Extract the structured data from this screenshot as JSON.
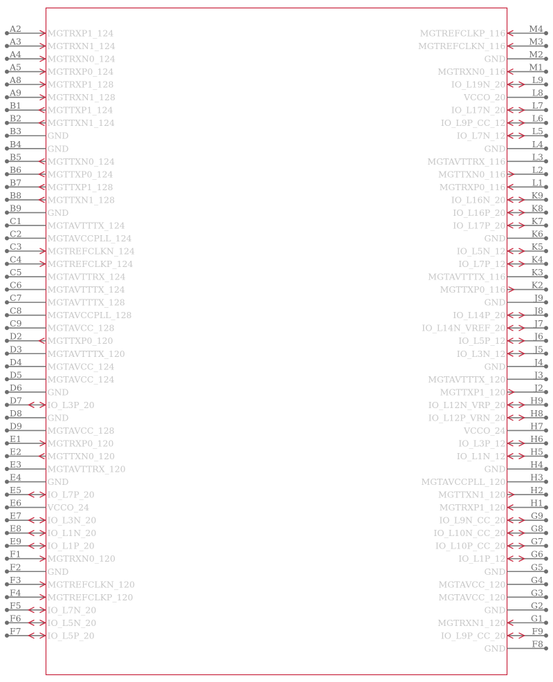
{
  "component": {
    "type": "schematic-symbol",
    "colors": {
      "body": "#c8243c",
      "pin_line": "#7a7a7a",
      "pin_name": "#c8c8c8",
      "pin_number": "#6e6e6e"
    }
  },
  "left_pins": [
    {
      "num": "A2",
      "name": "MGTRXP1_124",
      "dir": "in"
    },
    {
      "num": "A3",
      "name": "MGTRXN1_124",
      "dir": "in"
    },
    {
      "num": "A4",
      "name": "MGTRXN0_124",
      "dir": "in"
    },
    {
      "num": "A5",
      "name": "MGTRXP0_124",
      "dir": "in"
    },
    {
      "num": "A8",
      "name": "MGTRXP1_128",
      "dir": "in"
    },
    {
      "num": "A9",
      "name": "MGTRXN1_128",
      "dir": "in"
    },
    {
      "num": "B1",
      "name": "MGTTXP1_124",
      "dir": "out"
    },
    {
      "num": "B2",
      "name": "MGTTXN1_124",
      "dir": "out"
    },
    {
      "num": "B3",
      "name": "GND",
      "dir": "pwr"
    },
    {
      "num": "B4",
      "name": "GND",
      "dir": "pwr"
    },
    {
      "num": "B5",
      "name": "MGTTXN0_124",
      "dir": "out"
    },
    {
      "num": "B6",
      "name": "MGTTXP0_124",
      "dir": "out"
    },
    {
      "num": "B7",
      "name": "MGTTXP1_128",
      "dir": "out"
    },
    {
      "num": "B8",
      "name": "MGTTXN1_128",
      "dir": "out"
    },
    {
      "num": "B9",
      "name": "GND",
      "dir": "pwr"
    },
    {
      "num": "C1",
      "name": "MGTAVTTTX_124",
      "dir": "pwr"
    },
    {
      "num": "C2",
      "name": "MGTAVCCPLL_124",
      "dir": "pwr"
    },
    {
      "num": "C3",
      "name": "MGTREFCLKN_124",
      "dir": "in"
    },
    {
      "num": "C4",
      "name": "MGTREFCLKP_124",
      "dir": "in"
    },
    {
      "num": "C5",
      "name": "MGTAVTTRX_124",
      "dir": "pwr"
    },
    {
      "num": "C6",
      "name": "MGTAVTTTX_124",
      "dir": "pwr"
    },
    {
      "num": "C7",
      "name": "MGTAVTTTX_128",
      "dir": "pwr"
    },
    {
      "num": "C8",
      "name": "MGTAVCCPLL_128",
      "dir": "pwr"
    },
    {
      "num": "C9",
      "name": "MGTAVCC_128",
      "dir": "pwr"
    },
    {
      "num": "D2",
      "name": "MGTTXP0_120",
      "dir": "out"
    },
    {
      "num": "D3",
      "name": "MGTAVTTTX_120",
      "dir": "pwr"
    },
    {
      "num": "D4",
      "name": "MGTAVCC_124",
      "dir": "pwr"
    },
    {
      "num": "D5",
      "name": "MGTAVCC_124",
      "dir": "pwr"
    },
    {
      "num": "D6",
      "name": "GND",
      "dir": "pwr"
    },
    {
      "num": "D7",
      "name": "IO_L3P_20",
      "dir": "bidir"
    },
    {
      "num": "D8",
      "name": "GND",
      "dir": "pwr"
    },
    {
      "num": "D9",
      "name": "MGTAVCC_128",
      "dir": "pwr"
    },
    {
      "num": "E1",
      "name": "MGTRXP0_120",
      "dir": "in"
    },
    {
      "num": "E2",
      "name": "MGTTXN0_120",
      "dir": "out"
    },
    {
      "num": "E3",
      "name": "MGTAVTTRX_120",
      "dir": "pwr"
    },
    {
      "num": "E4",
      "name": "GND",
      "dir": "pwr"
    },
    {
      "num": "E5",
      "name": "IO_L7P_20",
      "dir": "bidir"
    },
    {
      "num": "E6",
      "name": "VCCO_24",
      "dir": "pwr"
    },
    {
      "num": "E7",
      "name": "IO_L3N_20",
      "dir": "bidir"
    },
    {
      "num": "E8",
      "name": "IO_L1N_20",
      "dir": "bidir"
    },
    {
      "num": "E9",
      "name": "IO_L1P_20",
      "dir": "bidir"
    },
    {
      "num": "F1",
      "name": "MGTRXN0_120",
      "dir": "in"
    },
    {
      "num": "F2",
      "name": "GND",
      "dir": "pwr"
    },
    {
      "num": "F3",
      "name": "MGTREFCLKN_120",
      "dir": "in"
    },
    {
      "num": "F4",
      "name": "MGTREFCLKP_120",
      "dir": "in"
    },
    {
      "num": "F5",
      "name": "IO_L7N_20",
      "dir": "bidir"
    },
    {
      "num": "F6",
      "name": "IO_L5N_20",
      "dir": "bidir"
    },
    {
      "num": "F7",
      "name": "IO_L5P_20",
      "dir": "bidir"
    }
  ],
  "right_pins": [
    {
      "num": "M4",
      "name": "MGTREFCLKP_116",
      "dir": "in"
    },
    {
      "num": "M3",
      "name": "MGTREFCLKN_116",
      "dir": "in"
    },
    {
      "num": "M2",
      "name": "GND",
      "dir": "pwr"
    },
    {
      "num": "M1",
      "name": "MGTRXN0_116",
      "dir": "in"
    },
    {
      "num": "L9",
      "name": "IO_L19N_20",
      "dir": "bidir"
    },
    {
      "num": "L8",
      "name": "VCCO_20",
      "dir": "pwr"
    },
    {
      "num": "L7",
      "name": "IO_L17N_20",
      "dir": "bidir"
    },
    {
      "num": "L6",
      "name": "IO_L9P_CC_12",
      "dir": "bidir"
    },
    {
      "num": "L5",
      "name": "IO_L7N_12",
      "dir": "bidir"
    },
    {
      "num": "L4",
      "name": "GND",
      "dir": "pwr"
    },
    {
      "num": "L3",
      "name": "MGTAVTTRX_116",
      "dir": "pwr"
    },
    {
      "num": "L2",
      "name": "MGTTXN0_116",
      "dir": "out"
    },
    {
      "num": "L1",
      "name": "MGTRXP0_116",
      "dir": "in"
    },
    {
      "num": "K9",
      "name": "IO_L16N_20",
      "dir": "bidir"
    },
    {
      "num": "K8",
      "name": "IO_L16P_20",
      "dir": "bidir"
    },
    {
      "num": "K7",
      "name": "IO_L17P_20",
      "dir": "bidir"
    },
    {
      "num": "K6",
      "name": "GND",
      "dir": "pwr"
    },
    {
      "num": "K5",
      "name": "IO_L5N_12",
      "dir": "bidir"
    },
    {
      "num": "K4",
      "name": "IO_L7P_12",
      "dir": "bidir"
    },
    {
      "num": "K3",
      "name": "MGTAVTTTX_116",
      "dir": "pwr"
    },
    {
      "num": "K2",
      "name": "MGTTXP0_116",
      "dir": "out"
    },
    {
      "num": "J9",
      "name": "GND",
      "dir": "pwr"
    },
    {
      "num": "J8",
      "name": "IO_L14P_20",
      "dir": "bidir"
    },
    {
      "num": "J7",
      "name": "IO_L14N_VREF_20",
      "dir": "bidir"
    },
    {
      "num": "J6",
      "name": "IO_L5P_12",
      "dir": "bidir"
    },
    {
      "num": "J5",
      "name": "IO_L3N_12",
      "dir": "bidir"
    },
    {
      "num": "J4",
      "name": "GND",
      "dir": "pwr"
    },
    {
      "num": "J3",
      "name": "MGTAVTTTX_120",
      "dir": "pwr"
    },
    {
      "num": "J2",
      "name": "MGTTXP1_120",
      "dir": "out"
    },
    {
      "num": "H9",
      "name": "IO_L12N_VRP_20",
      "dir": "bidir"
    },
    {
      "num": "H8",
      "name": "IO_L12P_VRN_20",
      "dir": "bidir"
    },
    {
      "num": "H7",
      "name": "VCCO_24",
      "dir": "pwr"
    },
    {
      "num": "H6",
      "name": "IO_L3P_12",
      "dir": "bidir"
    },
    {
      "num": "H5",
      "name": "IO_L1N_12",
      "dir": "bidir"
    },
    {
      "num": "H4",
      "name": "GND",
      "dir": "pwr"
    },
    {
      "num": "H3",
      "name": "MGTAVCCPLL_120",
      "dir": "pwr"
    },
    {
      "num": "H2",
      "name": "MGTTXN1_120",
      "dir": "out"
    },
    {
      "num": "H1",
      "name": "MGTRXP1_120",
      "dir": "in"
    },
    {
      "num": "G9",
      "name": "IO_L9N_CC_20",
      "dir": "bidir"
    },
    {
      "num": "G8",
      "name": "IO_L10N_CC_20",
      "dir": "bidir"
    },
    {
      "num": "G7",
      "name": "IO_L10P_CC_20",
      "dir": "bidir"
    },
    {
      "num": "G6",
      "name": "IO_L1P_12",
      "dir": "bidir"
    },
    {
      "num": "G5",
      "name": "GND",
      "dir": "pwr"
    },
    {
      "num": "G4",
      "name": "MGTAVCC_120",
      "dir": "pwr"
    },
    {
      "num": "G3",
      "name": "MGTAVCC_120",
      "dir": "pwr"
    },
    {
      "num": "G2",
      "name": "GND",
      "dir": "pwr"
    },
    {
      "num": "G1",
      "name": "MGTRXN1_120",
      "dir": "in"
    },
    {
      "num": "F9",
      "name": "IO_L9P_CC_20",
      "dir": "bidir"
    },
    {
      "num": "F8",
      "name": "GND",
      "dir": "pwr"
    }
  ]
}
